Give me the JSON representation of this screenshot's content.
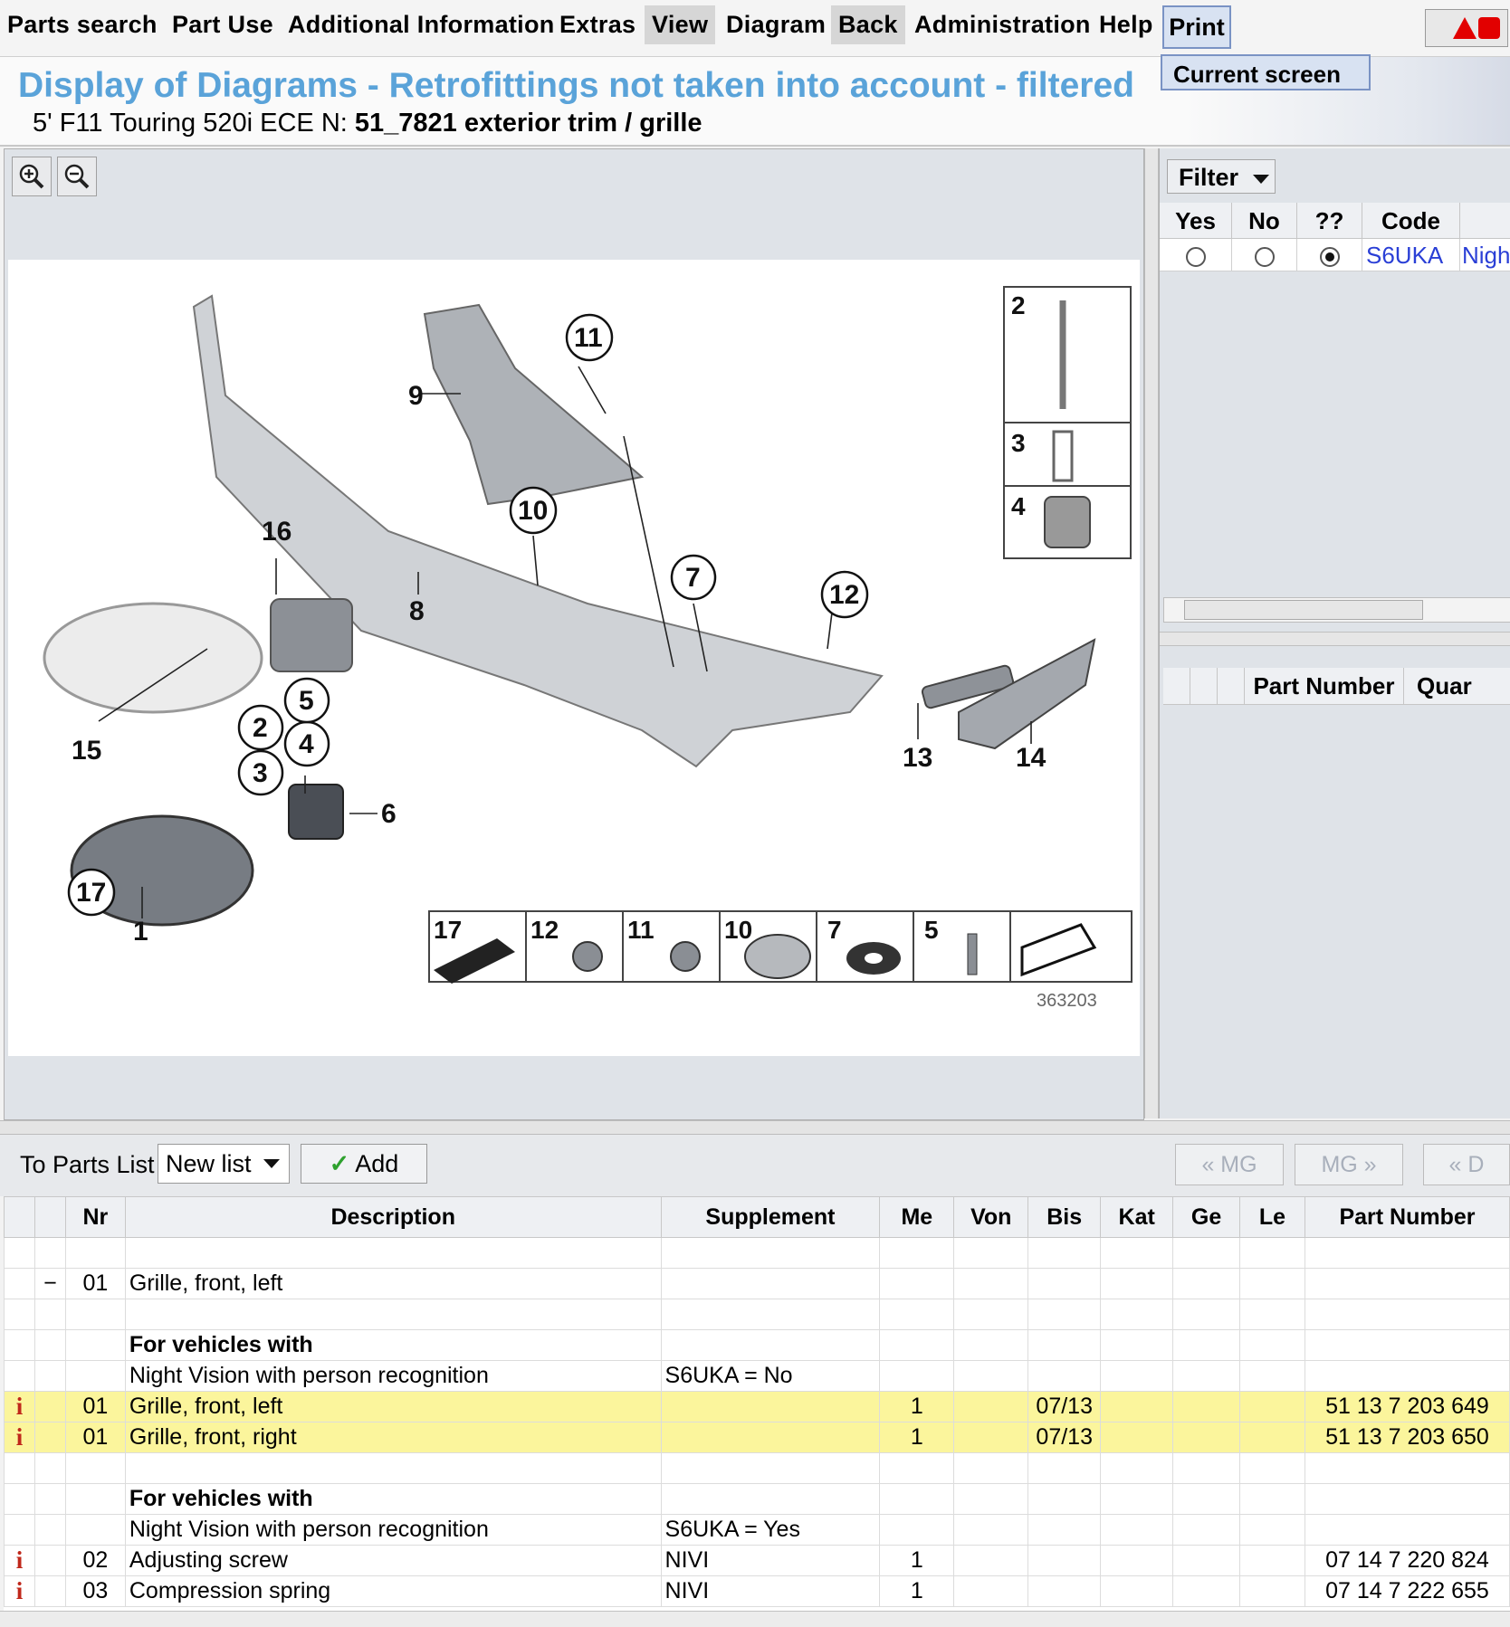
{
  "menu": {
    "items": [
      "Parts search",
      "Part Use",
      "Additional Information",
      "Extras",
      "View",
      "Diagram",
      "Back",
      "Administration",
      "Help"
    ],
    "print_label": "Print",
    "print_dropdown_item": "Current screen"
  },
  "header": {
    "title": "Display of Diagrams - Retrofittings not taken into account - filtered",
    "vehicle": "5' F11 Touring 520i ECE  N:",
    "diagram_name": "51_7821 exterior trim / grille"
  },
  "diagram": {
    "image_number": "363203",
    "callouts": [
      "1",
      "2",
      "3",
      "4",
      "5",
      "6",
      "7",
      "8",
      "9",
      "10",
      "11",
      "12",
      "13",
      "14",
      "15",
      "16",
      "17"
    ],
    "legend_items": [
      "17",
      "12",
      "11",
      "10",
      "7",
      "5"
    ],
    "inset_items": [
      "2",
      "3",
      "4"
    ]
  },
  "filter": {
    "button_label": "Filter",
    "columns": [
      "Yes",
      "No",
      "??",
      "Code",
      ""
    ],
    "rows": [
      {
        "selected": "??",
        "code": "S6UKA",
        "desc": "Nigh"
      }
    ],
    "parts_columns": [
      "Part Number",
      "Quar"
    ]
  },
  "toolbar": {
    "to_parts_list_label": "To Parts List",
    "list_value": "New list",
    "add_label": "Add",
    "nav_prev_mg": "« MG",
    "nav_next_mg": "MG »",
    "nav_prev_d": "« D"
  },
  "parts_table": {
    "columns": [
      "",
      "",
      "Nr",
      "Description",
      "Supplement",
      "Me",
      "Von",
      "Bis",
      "Kat",
      "Ge",
      "Le",
      "Part Number"
    ],
    "rows": [
      {
        "type": "blank"
      },
      {
        "type": "group",
        "toggle": "−",
        "nr": "01",
        "desc": "Grille, front, left"
      },
      {
        "type": "blank"
      },
      {
        "type": "cond",
        "desc": "For vehicles with"
      },
      {
        "type": "cond2",
        "desc": "Night Vision with person recognition",
        "supplement": "S6UKA = No"
      },
      {
        "type": "part",
        "hl": true,
        "nr": "01",
        "desc": "Grille, front, left",
        "supplement": "",
        "me": "1",
        "bis": "07/13",
        "pn": "51 13 7 203 649"
      },
      {
        "type": "part",
        "hl": true,
        "nr": "01",
        "desc": "Grille, front, right",
        "supplement": "",
        "me": "1",
        "bis": "07/13",
        "pn": "51 13 7 203 650"
      },
      {
        "type": "blank"
      },
      {
        "type": "cond",
        "desc": "For vehicles with"
      },
      {
        "type": "cond2",
        "desc": "Night Vision with person recognition",
        "supplement": "S6UKA = Yes"
      },
      {
        "type": "part",
        "hl": false,
        "nr": "02",
        "desc": "Adjusting screw",
        "supplement": "NIVI",
        "me": "1",
        "bis": "",
        "pn": "07 14 7 220 824"
      },
      {
        "type": "part",
        "hl": false,
        "nr": "03",
        "desc": "Compression spring",
        "supplement": "NIVI",
        "me": "1",
        "bis": "",
        "pn": "07 14 7 222 655"
      }
    ]
  },
  "icons": {
    "info": "i",
    "zoom_in": "zoom-in-icon",
    "zoom_out": "zoom-out-icon"
  },
  "colors": {
    "title_blue": "#5aa3d9",
    "highlight_row": "#fbf59c",
    "info_red": "#c0281b",
    "code_link": "#2a3fd6"
  }
}
